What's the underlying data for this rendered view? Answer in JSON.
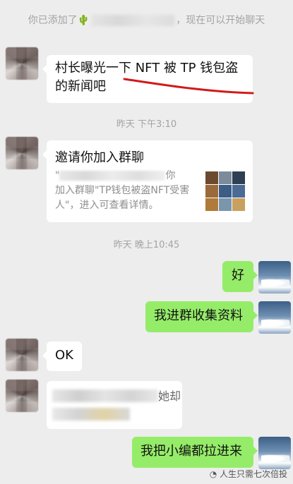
{
  "system": {
    "added_prefix": "你已添加了",
    "added_suffix": "，现在可以开始聊天",
    "emoji": "🌵",
    "ts1": "昨天 下午3:10",
    "ts2": "昨天 晚上10:45"
  },
  "messages": {
    "m1": "村长曝光一下 NFT 被 TP 钱包盗的新闻吧",
    "invite_title": "邀请你加入群聊",
    "invite_desc_open": "\"",
    "invite_desc_tail": "你",
    "invite_desc_rest": "加入群聊\"TP钱包被盗NFT受害人\"，进入可查看详情。",
    "reply_good": "好",
    "reply_collect": "我进群收集资料",
    "ok": "OK",
    "blur_tail": "她却",
    "last": "我把小编都拉进来"
  },
  "watermark": "人生只需七次倍投",
  "colors": {
    "out_bubble": "#95ec69",
    "in_bubble": "#ffffff",
    "background": "#ededed",
    "underline": "#d11a1a"
  }
}
